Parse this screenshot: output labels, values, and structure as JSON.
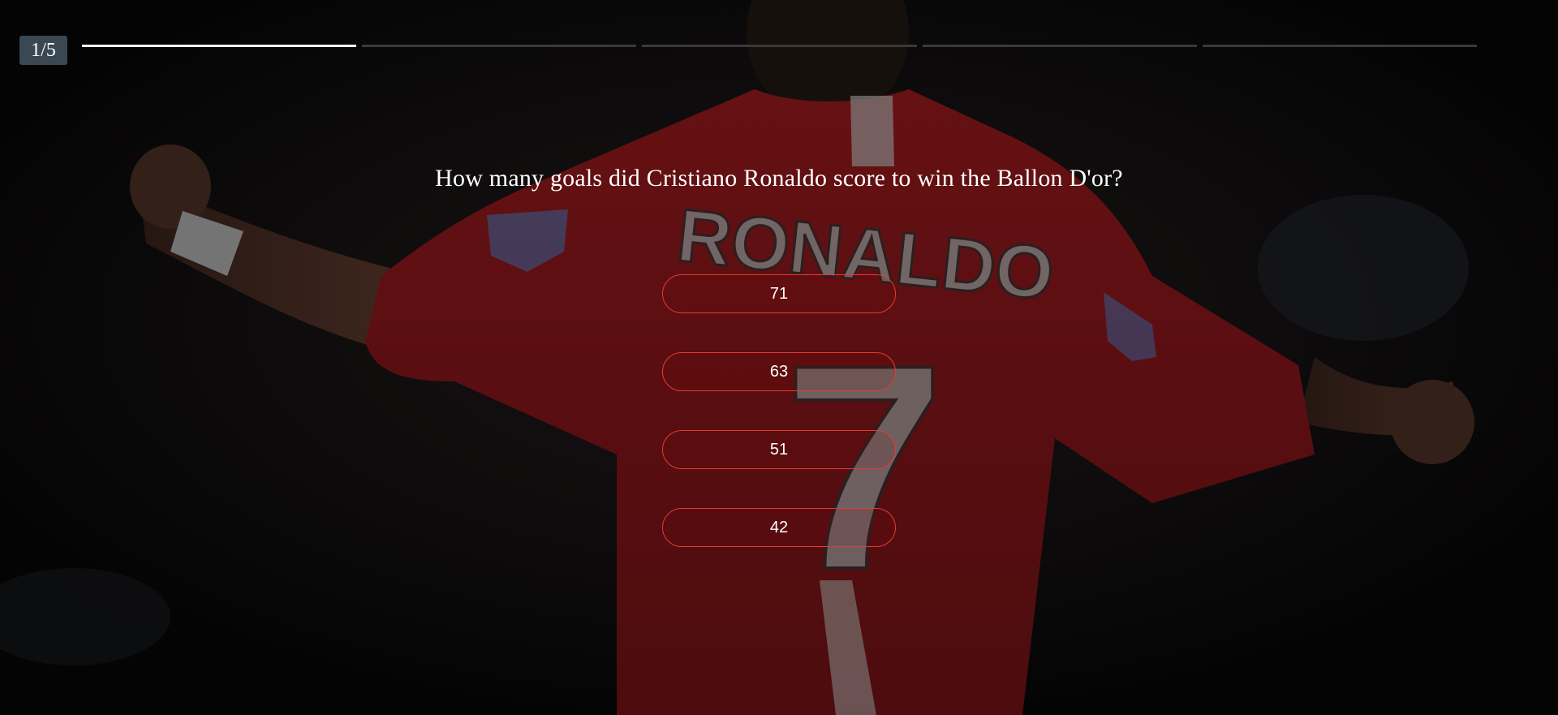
{
  "quiz": {
    "counter_label": "1/5",
    "progress": {
      "current": 1,
      "total": 5
    },
    "question": "How many goals did Cristiano Ronaldo score to win the Ballon D'or?",
    "answers": [
      {
        "label": "71"
      },
      {
        "label": "63"
      },
      {
        "label": "51"
      },
      {
        "label": "42"
      }
    ]
  },
  "background": {
    "jersey_name": "RONALDO",
    "jersey_number": "7"
  },
  "colors": {
    "answer_border": "#e53a35",
    "counter_bg": "#3a4853",
    "progress_active": "#ffffff",
    "progress_inactive": "#3a3a3a",
    "jersey": "#7a1417"
  }
}
